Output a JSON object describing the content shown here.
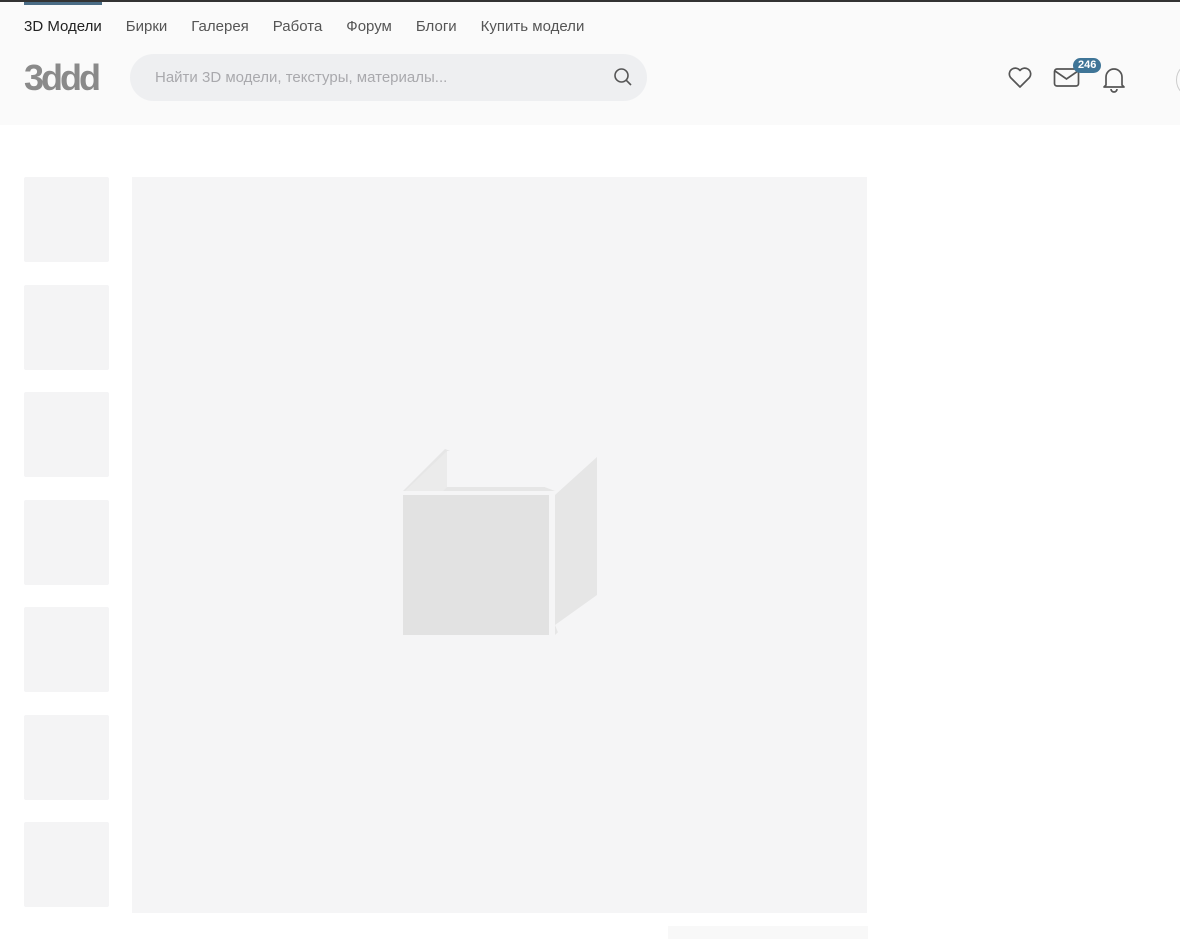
{
  "nav": {
    "items": [
      {
        "label": "3D Модели",
        "active": true
      },
      {
        "label": "Бирки"
      },
      {
        "label": "Галерея"
      },
      {
        "label": "Работа"
      },
      {
        "label": "Форум"
      },
      {
        "label": "Блоги"
      },
      {
        "label": "Купить модели"
      }
    ]
  },
  "logo": "3ddd",
  "search": {
    "placeholder": "Найти 3D модели, текстуры, материалы...",
    "value": ""
  },
  "header_icons": {
    "messages_badge": "246"
  },
  "colors": {
    "accent": "#4a6c85",
    "badge": "#3f7597"
  }
}
